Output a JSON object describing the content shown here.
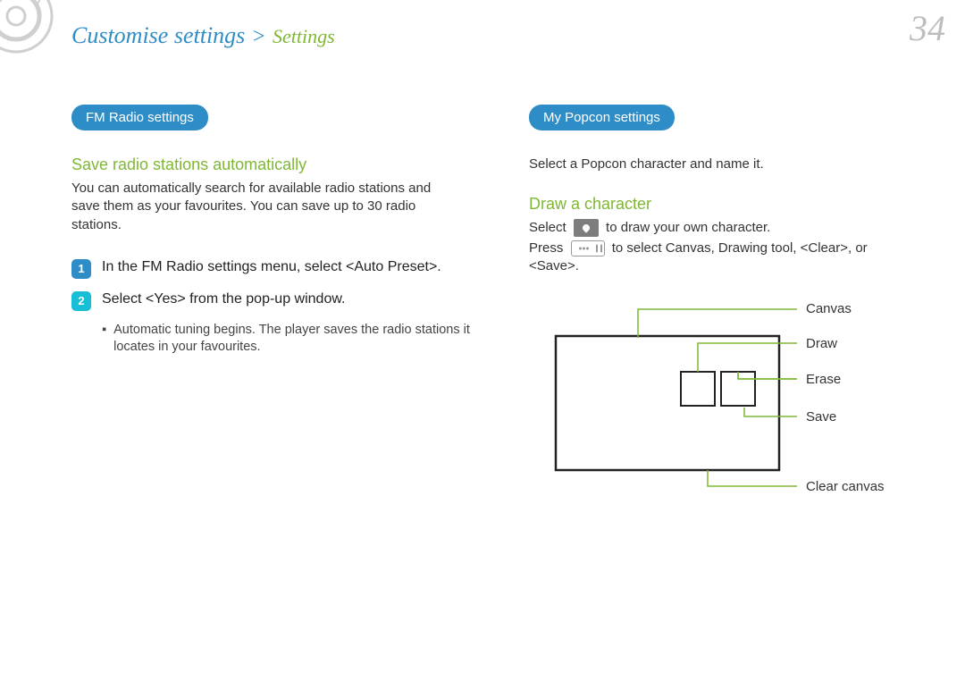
{
  "breadcrumb": {
    "main": "Customise settings",
    "sep": ">",
    "sub": "Settings"
  },
  "page_number": "34",
  "left": {
    "pill": "FM Radio settings",
    "heading": "Save radio stations automatically",
    "body": "You can automatically search for available radio stations and save them as your favourites. You can save up to 30 radio stations.",
    "step1_num": "1",
    "step1_text": "In the FM Radio settings menu, select <Auto Preset>.",
    "step2_num": "2",
    "step2_text": "Select <Yes> from the pop-up window.",
    "bullet": "Automatic tuning begins. The player saves the radio stations it locates in your favourites."
  },
  "right": {
    "pill": "My Popcon settings",
    "intro": "Select a Popcon character and name it.",
    "heading": "Draw a character",
    "select_before": "Select",
    "select_after": "to draw your own character.",
    "press_before": "Press",
    "press_after": "to select Canvas, Drawing tool, <Clear>, or <Save>.",
    "labels": {
      "canvas": "Canvas",
      "draw": "Draw",
      "erase": "Erase",
      "save": "Save",
      "clear": "Clear canvas"
    }
  }
}
